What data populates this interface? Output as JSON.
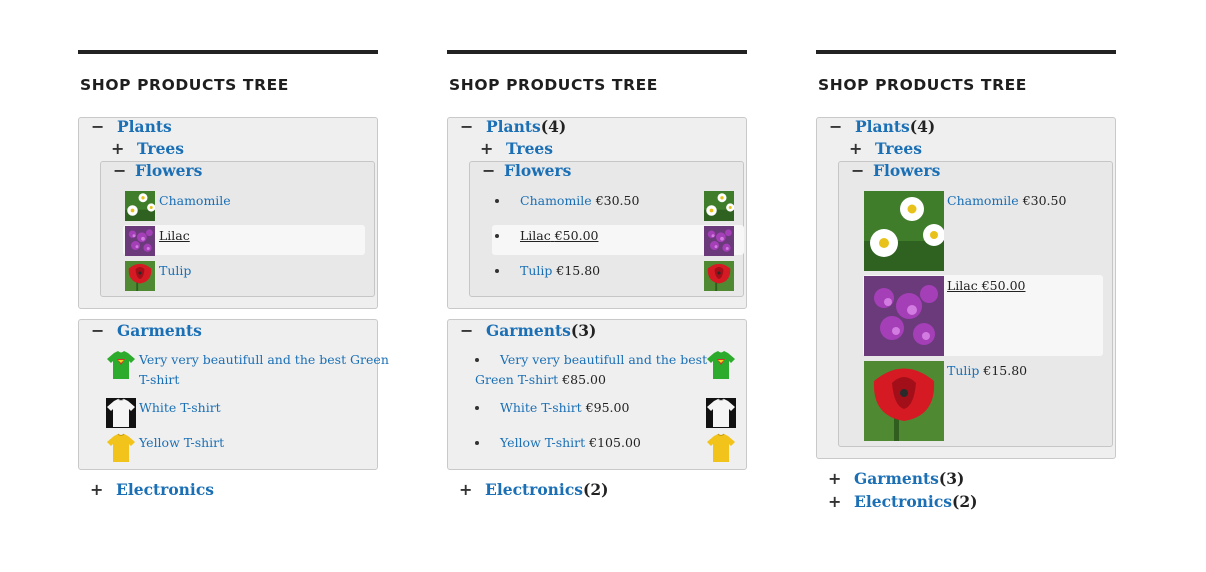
{
  "header": {
    "title": "SHOP PRODUCTS TREE"
  },
  "toggle": {
    "minus": "−",
    "plus": "+"
  },
  "categories": {
    "plants": "Plants",
    "trees": "Trees",
    "flowers": "Flowers",
    "garments": "Garments",
    "electronics": "Electronics"
  },
  "counts": {
    "plants": "(4)",
    "garments": "(3)",
    "electronics": "(2)"
  },
  "flowers": [
    {
      "name": "Chamomile",
      "price": "€30.50"
    },
    {
      "name": "Lilac",
      "price": "€50.00"
    },
    {
      "name": "Tulip",
      "price": "€15.80"
    }
  ],
  "garments": [
    {
      "name": "Very very beautifull and the best Green T-shirt",
      "name_line1": "Very very beautifull and the best Green",
      "name_line2": "T-shirt",
      "name_col2_line1": "Very very beautifull and the best",
      "name_col2_line2": "Green T-shirt",
      "price": "€85.00"
    },
    {
      "name": "White T-shirt",
      "price": "€95.00"
    },
    {
      "name": "Yellow T-shirt",
      "price": "€105.00"
    }
  ],
  "colors": {
    "link": "#1a6fb5",
    "box_bg": "#efefef",
    "sub_bg": "#e8e8e8",
    "highlight": "#f7f7f7"
  }
}
